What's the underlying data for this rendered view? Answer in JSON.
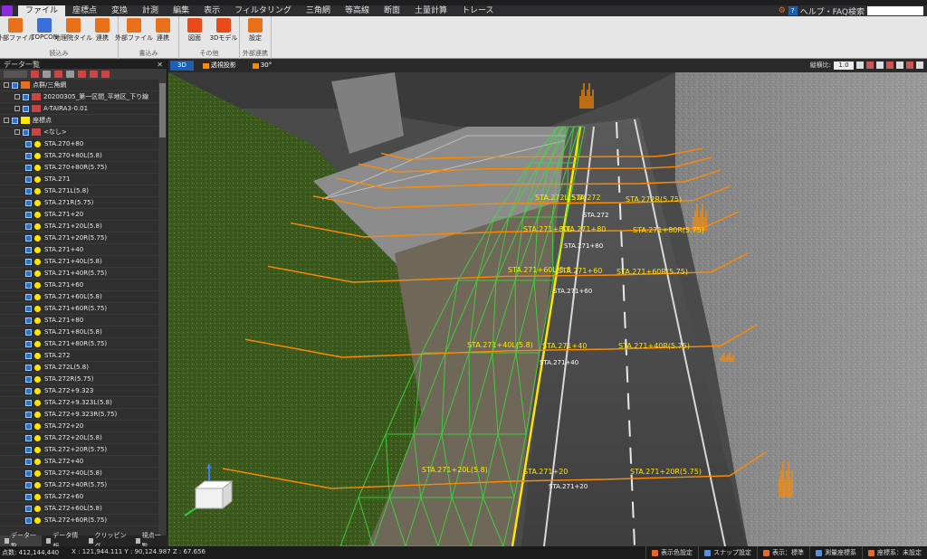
{
  "menu": {
    "items": [
      "ファイル",
      "座標点",
      "変換",
      "計測",
      "編集",
      "表示",
      "フィルタリング",
      "三角網",
      "等高線",
      "断面",
      "土量計算",
      "トレース"
    ],
    "active_index": 0,
    "help_label": "ヘルプ・FAQ検索"
  },
  "ribbon": {
    "groups": [
      {
        "label": "読込み",
        "buttons": [
          {
            "label": "外部ファイル",
            "icon": "file-import-icon",
            "color": "#e8701a"
          },
          {
            "label": "TOPCON",
            "icon": "topcon-icon",
            "color": "#3a6fd8"
          },
          {
            "label": "地理院タイル",
            "icon": "tile-icon",
            "color": "#e8701a"
          },
          {
            "label": "連携",
            "icon": "link-icon",
            "color": "#e8701a"
          }
        ]
      },
      {
        "label": "書込み",
        "buttons": [
          {
            "label": "外部ファイル",
            "icon": "file-export-icon",
            "color": "#e8701a"
          },
          {
            "label": "連携",
            "icon": "link-icon",
            "color": "#e8701a"
          }
        ]
      },
      {
        "label": "その他",
        "buttons": [
          {
            "label": "図面",
            "icon": "cad-icon",
            "color": "#e84a1a"
          },
          {
            "label": "3Dモデル",
            "icon": "model-3d-icon",
            "color": "#e84a1a"
          }
        ]
      },
      {
        "label": "外部連携",
        "buttons": [
          {
            "label": "設定",
            "icon": "gear-icon",
            "color": "#e8701a"
          }
        ]
      }
    ]
  },
  "left_panel": {
    "title": "データ一覧",
    "tree": [
      {
        "level": 0,
        "label": "点群/三角網",
        "type": "folder"
      },
      {
        "level": 1,
        "label": "20200305_第一区間_平地区_下り線",
        "type": "file"
      },
      {
        "level": 1,
        "label": "A-TAIRA3-0.01",
        "type": "file"
      },
      {
        "level": 0,
        "label": "座標点",
        "type": "points"
      },
      {
        "level": 1,
        "label": "<なし>",
        "type": "group"
      },
      {
        "level": 2,
        "label": "STA.270+80",
        "type": "point"
      },
      {
        "level": 2,
        "label": "STA.270+80L(5.8)",
        "type": "point"
      },
      {
        "level": 2,
        "label": "STA.270+80R(5.75)",
        "type": "point"
      },
      {
        "level": 2,
        "label": "STA.271",
        "type": "point"
      },
      {
        "level": 2,
        "label": "STA.271L(5.8)",
        "type": "point"
      },
      {
        "level": 2,
        "label": "STA.271R(5.75)",
        "type": "point"
      },
      {
        "level": 2,
        "label": "STA.271+20",
        "type": "point"
      },
      {
        "level": 2,
        "label": "STA.271+20L(5.8)",
        "type": "point"
      },
      {
        "level": 2,
        "label": "STA.271+20R(5.75)",
        "type": "point"
      },
      {
        "level": 2,
        "label": "STA.271+40",
        "type": "point"
      },
      {
        "level": 2,
        "label": "STA.271+40L(5.8)",
        "type": "point"
      },
      {
        "level": 2,
        "label": "STA.271+40R(5.75)",
        "type": "point"
      },
      {
        "level": 2,
        "label": "STA.271+60",
        "type": "point"
      },
      {
        "level": 2,
        "label": "STA.271+60L(5.8)",
        "type": "point"
      },
      {
        "level": 2,
        "label": "STA.271+60R(5.75)",
        "type": "point"
      },
      {
        "level": 2,
        "label": "STA.271+80",
        "type": "point"
      },
      {
        "level": 2,
        "label": "STA.271+80L(5.8)",
        "type": "point"
      },
      {
        "level": 2,
        "label": "STA.271+80R(5.75)",
        "type": "point"
      },
      {
        "level": 2,
        "label": "STA.272",
        "type": "point"
      },
      {
        "level": 2,
        "label": "STA.272L(5.8)",
        "type": "point"
      },
      {
        "level": 2,
        "label": "STA.272R(5.75)",
        "type": "point"
      },
      {
        "level": 2,
        "label": "STA.272+9.323",
        "type": "point"
      },
      {
        "level": 2,
        "label": "STA.272+9.323L(5.8)",
        "type": "point"
      },
      {
        "level": 2,
        "label": "STA.272+9.323R(5.75)",
        "type": "point"
      },
      {
        "level": 2,
        "label": "STA.272+20",
        "type": "point"
      },
      {
        "level": 2,
        "label": "STA.272+20L(5.8)",
        "type": "point"
      },
      {
        "level": 2,
        "label": "STA.272+20R(5.75)",
        "type": "point"
      },
      {
        "level": 2,
        "label": "STA.272+40",
        "type": "point"
      },
      {
        "level": 2,
        "label": "STA.272+40L(5.8)",
        "type": "point"
      },
      {
        "level": 2,
        "label": "STA.272+40R(5.75)",
        "type": "point"
      },
      {
        "level": 2,
        "label": "STA.272+60",
        "type": "point"
      },
      {
        "level": 2,
        "label": "STA.272+60L(5.8)",
        "type": "point"
      },
      {
        "level": 2,
        "label": "STA.272+60R(5.75)",
        "type": "point"
      }
    ]
  },
  "bottom_tabs": [
    "データ一覧",
    "データ情報",
    "クリッピング",
    "視点一覧"
  ],
  "view_toolbar": {
    "mode_3d": "3D",
    "projection": "透視投影",
    "angle": "30°",
    "ratio_label": "縦横比:",
    "ratio_value": "1.0"
  },
  "viewport_labels": [
    {
      "text": "STA.271+20L(5.8)",
      "color": "yellow"
    },
    {
      "text": "STA.271+20",
      "color": "yellow"
    },
    {
      "text": "STA.271+20R(5.75)",
      "color": "yellow"
    },
    {
      "text": "STA.271+40L(5.8)",
      "color": "yellow"
    },
    {
      "text": "STA.271+40",
      "color": "yellow"
    },
    {
      "text": "STA.271+40R(5.75)",
      "color": "yellow"
    },
    {
      "text": "STA.271+60L(5.8",
      "color": "yellow"
    },
    {
      "text": "STA.271+60",
      "color": "yellow"
    },
    {
      "text": "STA.271+60R(5.75)",
      "color": "yellow"
    },
    {
      "text": "STA.271+80L",
      "color": "yellow"
    },
    {
      "text": "STA.271+80",
      "color": "yellow"
    },
    {
      "text": "STA.271+80R(5.75)",
      "color": "yellow"
    },
    {
      "text": "STA.272L(5.8)",
      "color": "yellow"
    },
    {
      "text": "STA.272",
      "color": "yellow"
    },
    {
      "text": "STA.272R(5.75)",
      "color": "yellow"
    },
    {
      "text": "STA.271+20",
      "color": "white"
    },
    {
      "text": "STA.271+40",
      "color": "white"
    },
    {
      "text": "STA.271+60",
      "color": "white"
    },
    {
      "text": "STA.271+80",
      "color": "white"
    },
    {
      "text": "STA.272",
      "color": "white"
    }
  ],
  "status_bar": {
    "point_count": "点数: 412,144,440",
    "coords": "X : 121,944.111  Y : 90,124.987  Z : 67.656",
    "buttons": [
      "表示色設定",
      "スナップ設定",
      "表示：標準",
      "測量座標系",
      "座標系：未設定"
    ]
  },
  "colors": {
    "accent": "#1e5fb4",
    "ribbon_bg": "#e6e6e6",
    "label_yellow": "#ffe600",
    "section_orange": "#ff8a00",
    "mesh_green": "#3ddc3d"
  }
}
